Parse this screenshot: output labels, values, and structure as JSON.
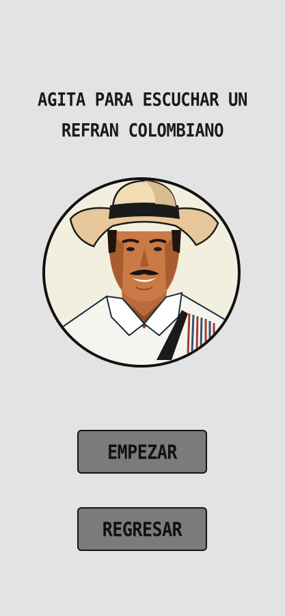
{
  "screen": {
    "title_line1": "AGITA PARA ESCUCHAR UN",
    "title_line2": "REFRAN COLOMBIANO"
  },
  "buttons": {
    "start_label": "EMPEZAR",
    "back_label": "REGRESAR"
  },
  "colors": {
    "background": "#e3e3e3",
    "button_fill": "#7b7b7b",
    "portrait_bg": "#f3efdf"
  },
  "icons": {
    "portrait": "colombian-man-sombrero-illustration"
  }
}
